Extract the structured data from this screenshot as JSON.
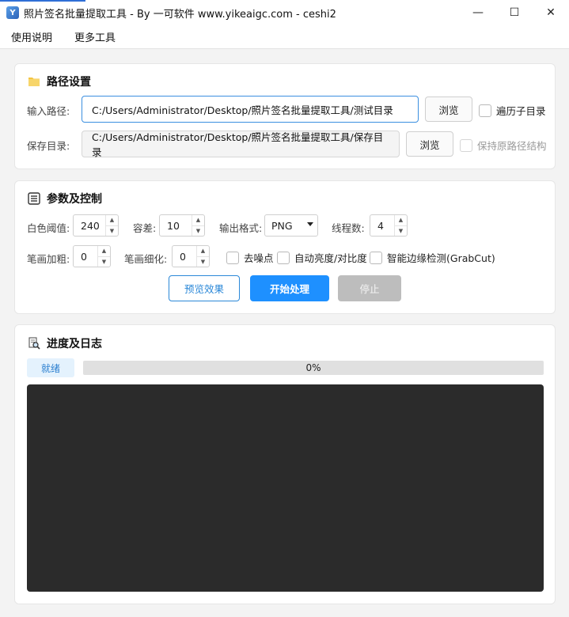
{
  "window": {
    "title": "照片签名批量提取工具 - By 一可软件 www.yikeaigc.com - ceshi2",
    "icon": "app-logo-icon",
    "minimize": "—",
    "maximize": "☐",
    "close": "✕"
  },
  "menu": [
    "使用说明",
    "更多工具"
  ],
  "path_section": {
    "title": "路径设置",
    "icon": "folder-icon",
    "input_label": "输入路径:",
    "input_value": "C:/Users/Administrator/Desktop/照片签名批量提取工具/测试目录",
    "browse_label": "浏览",
    "recursive_label": "遍历子目录",
    "recursive_checked": false,
    "output_label": "保存目录:",
    "output_value": "C:/Users/Administrator/Desktop/照片签名批量提取工具/保存目录",
    "browse2_label": "浏览",
    "keep_structure_label": "保持原路径结构",
    "keep_structure_checked": false
  },
  "params_section": {
    "title": "参数及控制",
    "icon": "list-icon",
    "white_threshold_label": "白色阈值:",
    "white_threshold": "240",
    "tolerance_label": "容差:",
    "tolerance": "10",
    "format_label": "输出格式:",
    "format": "PNG",
    "threads_label": "线程数:",
    "threads": "4",
    "stroke_bold_label": "笔画加粗:",
    "stroke_bold": "0",
    "stroke_thin_label": "笔画细化:",
    "stroke_thin": "0",
    "denoise_label": "去噪点",
    "auto_contrast_label": "自动亮度/对比度",
    "grabcut_label": "智能边缘检测(GrabCut)",
    "preview_label": "预览效果",
    "start_label": "开始处理",
    "stop_label": "停止"
  },
  "log_section": {
    "title": "进度及日志",
    "icon": "search-document-icon",
    "status": "就绪",
    "progress": 0,
    "progress_text": "0%"
  },
  "colors": {
    "accent": "#1e90ff",
    "log_bg": "#2b2b2b",
    "disabled": "#bdbdbd"
  }
}
